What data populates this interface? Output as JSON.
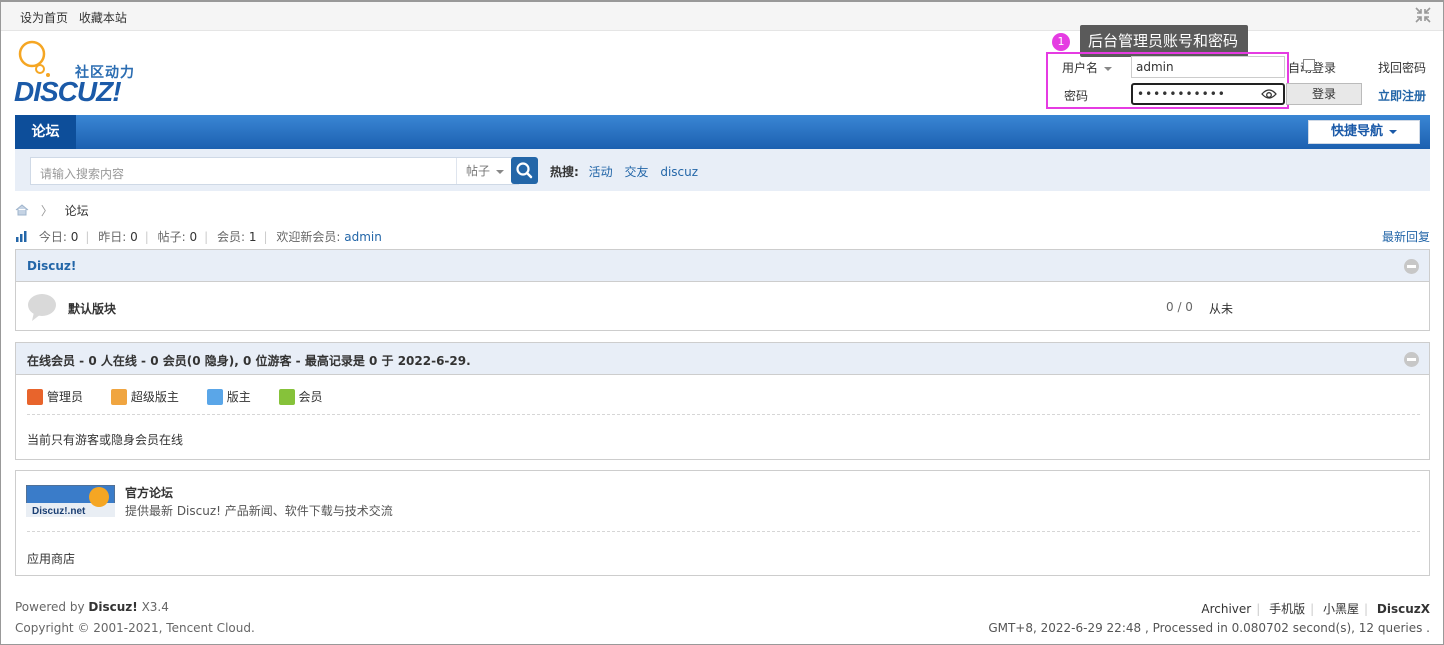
{
  "topbar": {
    "set_home": "设为首页",
    "bookmark": "收藏本站"
  },
  "logo": {
    "slogan": "社区动力",
    "wordmark": "DISCUZ!"
  },
  "annotation": {
    "number": "1",
    "text": "后台管理员账号和密码"
  },
  "login": {
    "username_label": "用户名",
    "username_value": "admin",
    "password_label": "密码",
    "password_value": "•••••••••••",
    "auto_login": "自动登录",
    "find_password": "找回密码",
    "login_button": "登录",
    "register": "立即注册"
  },
  "nav": {
    "tab": "论坛",
    "quick_nav": "快捷导航"
  },
  "search": {
    "placeholder": "请输入搜索内容",
    "type": "帖子",
    "hot_label": "热搜:",
    "hot": [
      "活动",
      "交友",
      "discuz"
    ]
  },
  "breadcrumb": {
    "current": "论坛"
  },
  "stats": {
    "today_label": "今日:",
    "today": "0",
    "yesterday_label": "昨日:",
    "yesterday": "0",
    "posts_label": "帖子:",
    "posts": "0",
    "members_label": "会员:",
    "members": "1",
    "welcome_label": "欢迎新会员:",
    "new_member": "admin",
    "latest_reply": "最新回复"
  },
  "category": {
    "title": "Discuz!",
    "forum_name": "默认版块",
    "counts": "0 / 0",
    "last_post": "从未"
  },
  "online": {
    "title": "在线会员 - 0 人在线 - 0 会员(0 隐身), 0 位游客 - 最高记录是 0 于 2022-6-29.",
    "legend": [
      {
        "label": "管理员",
        "color": "#e8642c"
      },
      {
        "label": "超级版主",
        "color": "#f0a540"
      },
      {
        "label": "版主",
        "color": "#5aa6e8"
      },
      {
        "label": "会员",
        "color": "#86c23a"
      }
    ],
    "note": "当前只有游客或隐身会员在线"
  },
  "links": {
    "logo_text": "Discuz!.net",
    "title": "官方论坛",
    "desc": "提供最新 Discuz! 产品新闻、软件下载与技术交流",
    "appstore": "应用商店"
  },
  "footer": {
    "powered_prefix": "Powered by",
    "powered_brand": "Discuz!",
    "version": "X3.4",
    "copyright": "Copyright © 2001-2021, Tencent Cloud.",
    "links": [
      "Archiver",
      "手机版",
      "小黑屋"
    ],
    "brand": "DiscuzX",
    "status": "GMT+8, 2022-6-29 22:48 , Processed in 0.080702 second(s), 12 queries ."
  },
  "colors": {
    "accent": "#2366a8",
    "annotation": "#e53be2"
  }
}
